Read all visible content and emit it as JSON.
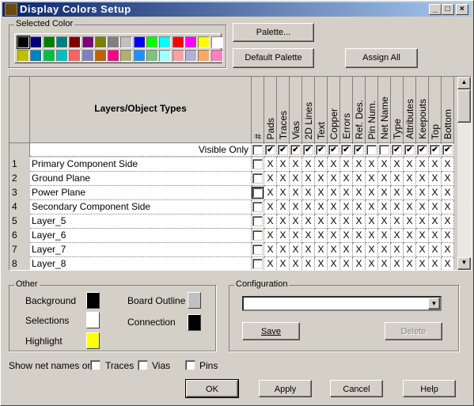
{
  "window": {
    "title": "Display Colors Setup",
    "icon_text": "PADS",
    "minimize": "_",
    "maximize": "□",
    "close": "×"
  },
  "selected_color": {
    "label": "Selected Color",
    "colors": [
      "#000000",
      "#000080",
      "#008000",
      "#008080",
      "#800000",
      "#800080",
      "#808000",
      "#808080",
      "#c0c0c0",
      "#0000ff",
      "#00ff00",
      "#00ffff",
      "#ff0000",
      "#ff00ff",
      "#ffff00",
      "#ffffff",
      "#c0c000",
      "#0080c0",
      "#00c040",
      "#00c0c0",
      "#ff6060",
      "#8080c0",
      "#c06000",
      "#ff0080",
      "#b0b070",
      "#2090ff",
      "#80c080",
      "#a0ffff",
      "#ffa0a0",
      "#b0b0d8",
      "#ffa860",
      "#ff80c0"
    ],
    "selected_index": 0
  },
  "buttons": {
    "palette": "Palette...",
    "default_palette": "Default Palette",
    "assign_all": "Assign All",
    "ok": "OK",
    "apply": "Apply",
    "cancel": "Cancel",
    "help": "Help"
  },
  "grid": {
    "name_header": "Layers/Object Types",
    "columns": [
      "#",
      "Pads",
      "Traces",
      "Vias",
      "2D Lines",
      "Text",
      "Copper",
      "Errors",
      "Ref. Des.",
      "Pin Num.",
      "Net Name",
      "Type",
      "Attributes",
      "Keepouts",
      "Top",
      "Bottom"
    ],
    "visible_only_label": "Visible Only",
    "visible_only": [
      false,
      true,
      true,
      true,
      true,
      true,
      true,
      true,
      true,
      false,
      false,
      true,
      true,
      true,
      true,
      true
    ],
    "cell_mark": "X",
    "rows": [
      {
        "num": "1",
        "name": "Primary Component Side"
      },
      {
        "num": "2",
        "name": "Ground Plane"
      },
      {
        "num": "3",
        "name": "Power Plane"
      },
      {
        "num": "4",
        "name": "Secondary Component Side"
      },
      {
        "num": "5",
        "name": "Layer_5"
      },
      {
        "num": "6",
        "name": "Layer_6"
      },
      {
        "num": "7",
        "name": "Layer_7"
      },
      {
        "num": "8",
        "name": "Layer_8"
      }
    ]
  },
  "other": {
    "label": "Other",
    "background": {
      "label": "Background",
      "color": "#000000"
    },
    "selections": {
      "label": "Selections",
      "color": "#ffffff"
    },
    "highlight": {
      "label": "Highlight",
      "color": "#ffff00"
    },
    "board_outline": {
      "label": "Board Outline",
      "color": "#c0c0c0"
    },
    "connection": {
      "label": "Connection",
      "color": "#000000"
    }
  },
  "configuration": {
    "label": "Configuration",
    "value": "",
    "save": "Save",
    "delete": "Delete"
  },
  "net_names": {
    "label": "Show net names on",
    "traces": "Traces",
    "vias": "Vias",
    "pins": "Pins"
  }
}
